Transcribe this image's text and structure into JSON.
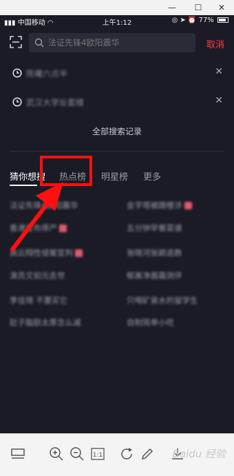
{
  "window": {
    "minimize": "—",
    "maximize": "☐",
    "close": "✕"
  },
  "status_bar": {
    "carrier": "中国移动",
    "time": "上午1:12",
    "battery": "77%"
  },
  "search": {
    "placeholder": "法证先锋4欧阳震华",
    "cancel_label": "取消"
  },
  "history": [
    {
      "text": "陈曦六点半"
    },
    {
      "text": "武汉大学反套楼"
    }
  ],
  "all_history_label": "全部搜索记录",
  "tabs": [
    {
      "label": "猜你想搜",
      "active": true
    },
    {
      "label": "热点榜",
      "active": false
    },
    {
      "label": "明星榜",
      "active": false
    },
    {
      "label": "更多",
      "active": false
    }
  ],
  "hot_list": {
    "left": [
      {
        "text": "法证先锋4欧阳震华",
        "hot": false
      },
      {
        "text": "香港宣布停产",
        "hot": true
      },
      {
        "text": "高云翔性侵案宣判",
        "hot": true
      },
      {
        "text": "演员文如元去世",
        "hot": false
      },
      {
        "text": "李佳琦 不要买它",
        "hot": false
      },
      {
        "text": "肚子脂肪太厚怎么减",
        "hot": false
      }
    ],
    "right": [
      {
        "text": "金字塔被蹭楼涉",
        "hot": true
      },
      {
        "text": "五分钟早餐菜谱",
        "hot": false
      },
      {
        "text": "张晓河张颖逃数",
        "hot": false
      },
      {
        "text": "郁美净面霜测评",
        "hot": false
      },
      {
        "text": "只喝矿泉水的留学生",
        "hot": false
      },
      {
        "text": "自制简单小吃",
        "hot": false
      }
    ]
  },
  "annotation": {
    "color": "#ff1010"
  },
  "toolbar": {
    "zoom_reset_label": "1:1",
    "watermark": "Baidu 经验"
  }
}
